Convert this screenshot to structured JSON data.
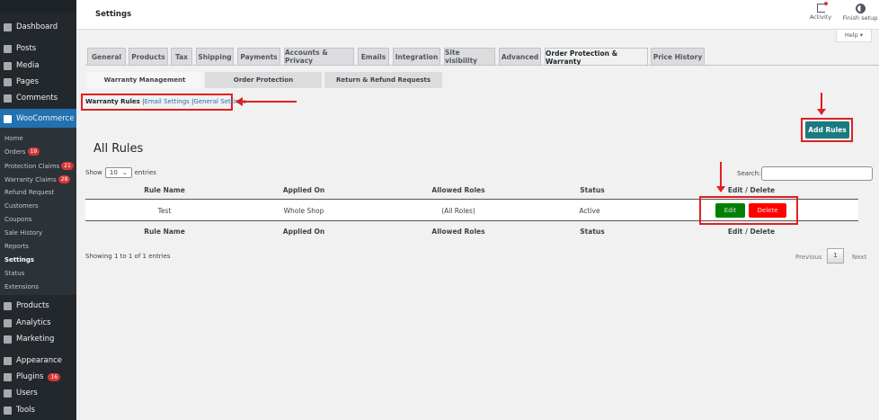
{
  "sidebar": {
    "top": [
      {
        "label": "Dashboard"
      },
      {
        "label": "Posts"
      },
      {
        "label": "Media"
      },
      {
        "label": "Pages"
      },
      {
        "label": "Comments"
      }
    ],
    "woocommerce": "WooCommerce",
    "sub": [
      {
        "label": "Home"
      },
      {
        "label": "Orders",
        "badge": "19"
      },
      {
        "label": "Protection Claims",
        "badge": "21"
      },
      {
        "label": "Warranty Claims",
        "badge": "28"
      },
      {
        "label": "Refund Request"
      },
      {
        "label": "Customers"
      },
      {
        "label": "Coupons"
      },
      {
        "label": "Sale History"
      },
      {
        "label": "Reports"
      },
      {
        "label": "Settings"
      },
      {
        "label": "Status"
      },
      {
        "label": "Extensions"
      }
    ],
    "bottom": [
      {
        "label": "Products"
      },
      {
        "label": "Analytics"
      },
      {
        "label": "Marketing"
      },
      {
        "label": "Appearance"
      },
      {
        "label": "Plugins",
        "badge": "16"
      },
      {
        "label": "Users"
      },
      {
        "label": "Tools"
      }
    ]
  },
  "header": {
    "title": "Settings",
    "activity": "Activity",
    "finish_setup": "Finish setup",
    "help": "Help ▾"
  },
  "tabs": [
    "General",
    "Products",
    "Tax",
    "Shipping",
    "Payments",
    "Accounts & Privacy",
    "Emails",
    "Integration",
    "Site visibility",
    "Advanced",
    "Order Protection & Warranty",
    "Price History"
  ],
  "subtabs": [
    "Warranty Management",
    "Order Protection",
    "Return & Refund Requests"
  ],
  "links": {
    "current": "Warranty Rules",
    "email": "Email Settings",
    "general": "General Settings",
    "sep": "|"
  },
  "add_rules": "Add Rules",
  "title": "All Rules",
  "show": {
    "prefix": "Show",
    "value": "10",
    "suffix": "entries"
  },
  "search_label": "Search:",
  "columns": [
    "Rule Name",
    "Applied On",
    "Allowed Roles",
    "Status",
    "Edit / Delete"
  ],
  "rows": [
    {
      "name": "Test",
      "applied": "Whole Shop",
      "roles": "(All Roles)",
      "status": "Active",
      "edit": "Edit",
      "delete": "Delete"
    }
  ],
  "info": "Showing 1 to 1 of 1 entries",
  "pagination": {
    "previous": "Previous",
    "page": "1",
    "next": "Next"
  }
}
